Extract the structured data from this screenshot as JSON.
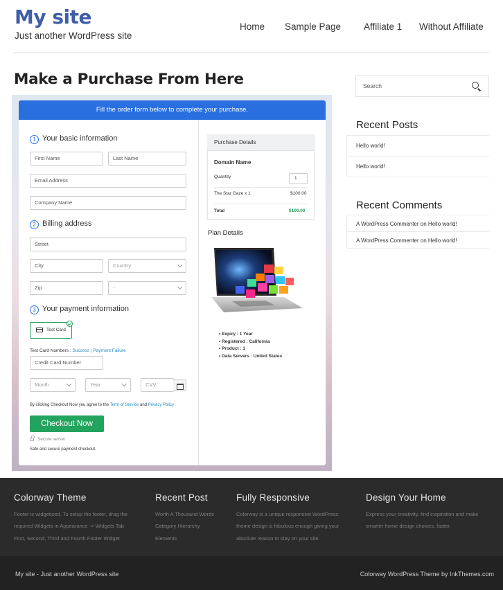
{
  "header": {
    "site_title": "My site",
    "tagline": "Just another WordPress site",
    "nav": [
      "Home",
      "Sample Page",
      "Affiliate 1",
      "Without Affiliate"
    ]
  },
  "main": {
    "heading": "Make a Purchase From Here",
    "banner": "Fill the order form below to complete your purchase.",
    "steps": [
      "Your basic information",
      "Billing address",
      "Your payment information"
    ],
    "step_numbers": [
      "1",
      "2",
      "3"
    ],
    "placeholders": {
      "first_name": "First Name",
      "last_name": "Last Name",
      "email": "Email Address",
      "company": "Company Name",
      "street": "Street",
      "city": "City",
      "country": "Country",
      "zip": "Zip",
      "state": "-",
      "card_number": "Credit Card Number",
      "month": "Month",
      "year": "Year",
      "cvv": "CVV"
    },
    "payment_method": "Test Card",
    "test_card_label": "Test Card Numbers :",
    "test_success": "Success",
    "test_sep": "|",
    "test_failure": "Payment Failure",
    "terms_prefix": "By clicking Checkout Now you agree to the",
    "terms_link": "Term of Service",
    "terms_and": "and",
    "privacy_link": "Privacy Policy",
    "checkout_button": "Checkout Now",
    "secure_server": "Secure server",
    "secure_note": "Safe and secure payment checkout."
  },
  "purchase": {
    "title": "Purchase Details",
    "domain_label": "Domain Name",
    "quantity_label": "Quantity",
    "quantity_value": "1",
    "item_name": "The Star Gaze x 1",
    "item_price": "$100.00",
    "total_label": "Total",
    "total_value": "$100.00",
    "total_color": "#1fa05a"
  },
  "plan": {
    "title": "Plan Details",
    "image_icon": "laptop-domains-image",
    "details": [
      "Expiry : 1 Year",
      "Registered : California",
      "Product : 1",
      "Data Servers : United States"
    ]
  },
  "sidebar": {
    "search_placeholder": "Search",
    "recent_posts_title": "Recent Posts",
    "recent_posts": [
      "Hello world!",
      "Hello world!"
    ],
    "recent_comments_title": "Recent Comments",
    "comment_author": "A WordPress Commenter",
    "comment_on": "on",
    "comment_post": "Hello world!"
  },
  "footer": {
    "col1_title": "Colorway Theme",
    "col1_text": [
      "Footer is widgetized. To setup the footer, drag the",
      "required Widgets in Appearance -> Widgets Tab",
      "First, Second, Third and Fourth Footer Widget"
    ],
    "col2_title": "Recent Post",
    "col2_text": [
      "Worth A Thousand Words",
      "Category Hierarchy",
      "Elements"
    ],
    "col3_title": "Fully Responsive",
    "col3_text": [
      "Colorway is a unique responsive WordPress",
      "theme design is fabulous enough giving your",
      "absolute reason to stay on your site."
    ],
    "col4_title": "Design Your Home",
    "col4_text": [
      "Express your creativity, find inspiration and make",
      "smarter home design choices, faster."
    ],
    "bottom_left": "My site - Just another WordPress site",
    "bottom_right": "Colorway WordPress Theme by InkThemes.com"
  },
  "colors": {
    "brand": "#3f5ea8",
    "banner": "#2a6fe0",
    "checkout": "#23a45e",
    "link": "#1f8ac7"
  }
}
